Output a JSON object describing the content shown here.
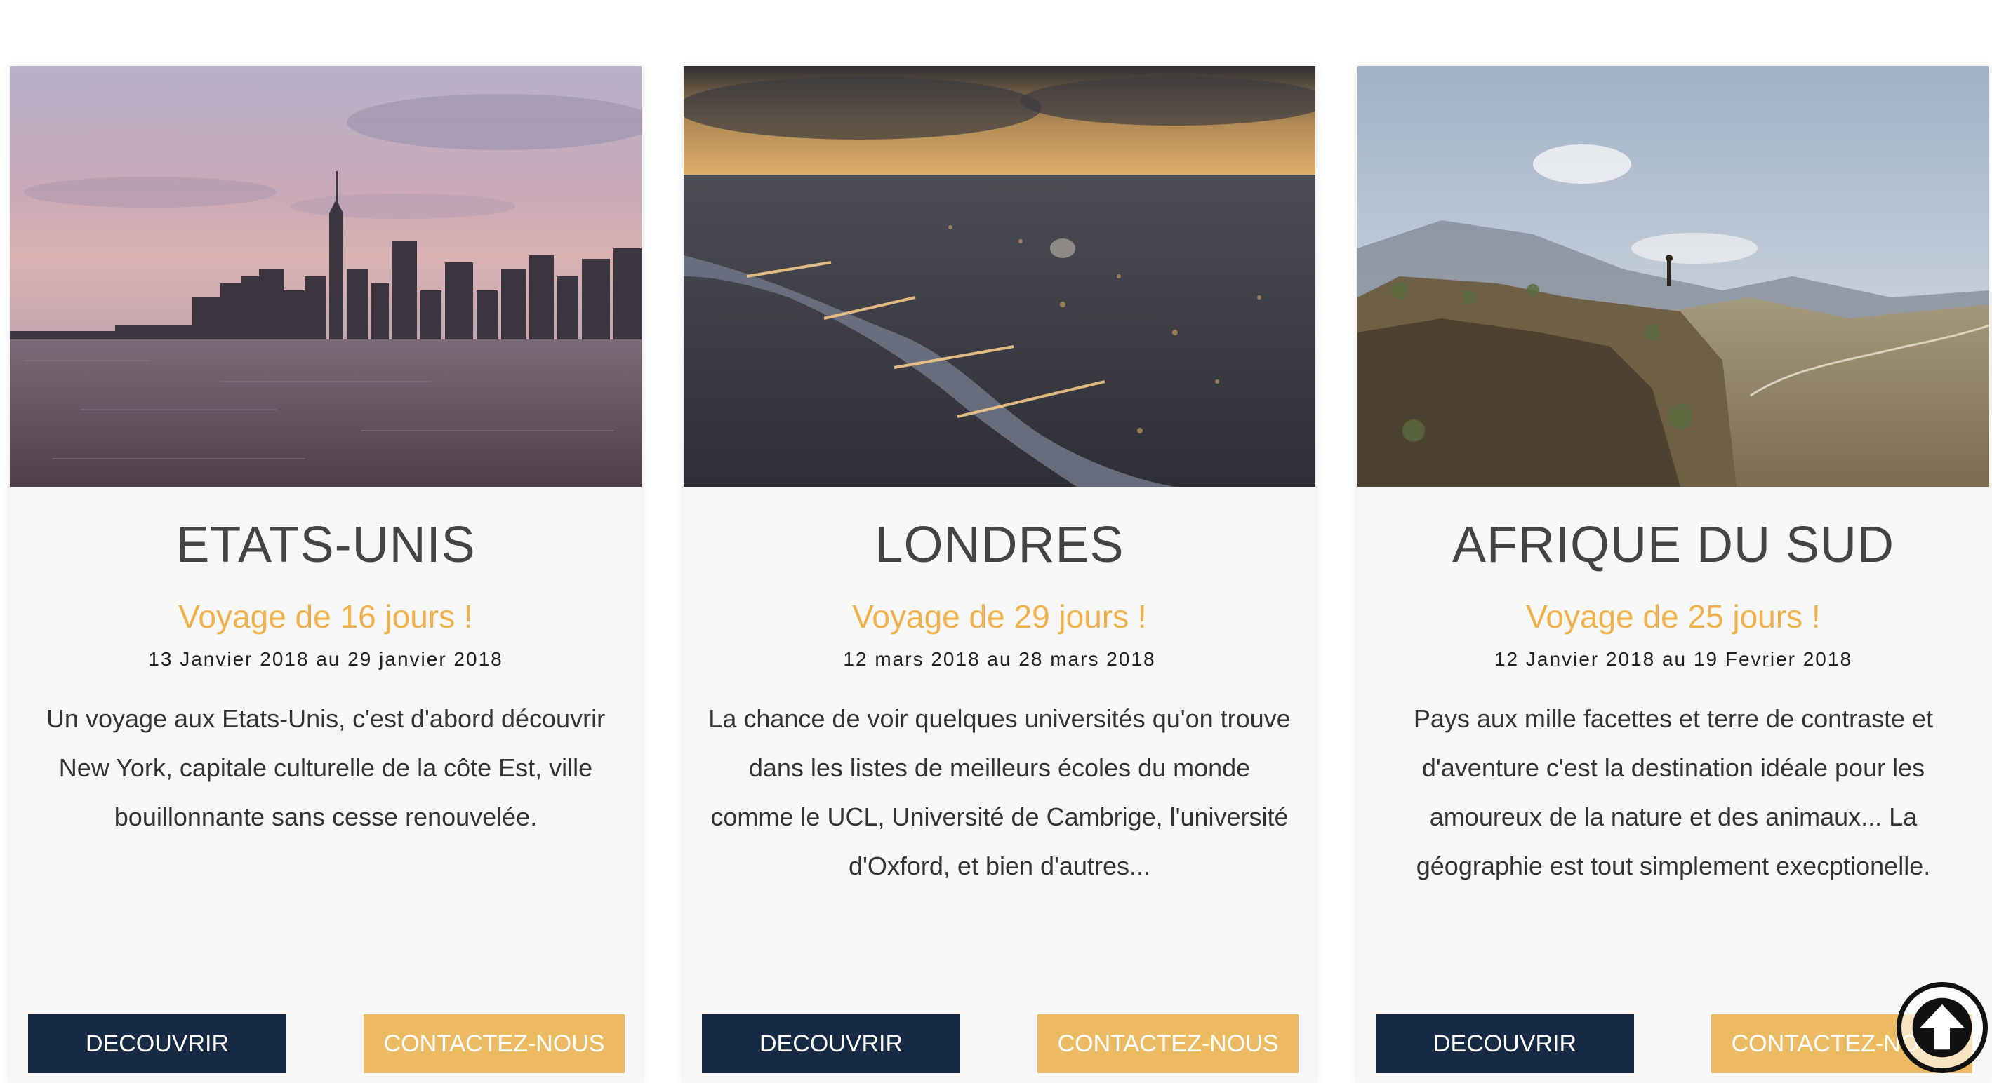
{
  "cards": [
    {
      "title": "ETATS-UNIS",
      "subtitle": "Voyage de 16 jours !",
      "dates": "13 Janvier 2018 au 29 janvier 2018",
      "description": "Un voyage aux Etats-Unis, c'est d'abord découvrir New York, capitale culturelle de la côte Est, ville bouillonnante sans cesse renouvelée.",
      "discover_label": "DECOUVRIR",
      "contact_label": "CONTACTEZ-NOUS"
    },
    {
      "title": "LONDRES",
      "subtitle": "Voyage de 29 jours !",
      "dates": "12 mars 2018 au 28 mars 2018",
      "description": "La chance de voir quelques universités qu'on trouve dans les listes de meilleurs écoles du monde comme le UCL, Université de Cambrige, l'université d'Oxford, et bien d'autres...",
      "discover_label": "DECOUVRIR",
      "contact_label": "CONTACTEZ-NOUS"
    },
    {
      "title": "AFRIQUE DU SUD",
      "subtitle": "Voyage de 25 jours !",
      "dates": "12 Janvier 2018 au 19 Fevrier 2018",
      "description": "Pays aux mille facettes et terre de contraste et d'aventure c'est la destination idéale pour les amoureux de la nature et des animaux... La géographie est tout simplement execptionelle.",
      "discover_label": "DECOUVRIR",
      "contact_label": "CONTACTEZ-NOUS"
    }
  ],
  "scroll_top": {
    "icon": "arrow-up-circle-icon"
  },
  "colors": {
    "accent": "#f0b04a",
    "discover_button": "#172a43",
    "contact_button": "#ecba62",
    "card_background": "#f8f7f7",
    "title_text": "#444444"
  }
}
